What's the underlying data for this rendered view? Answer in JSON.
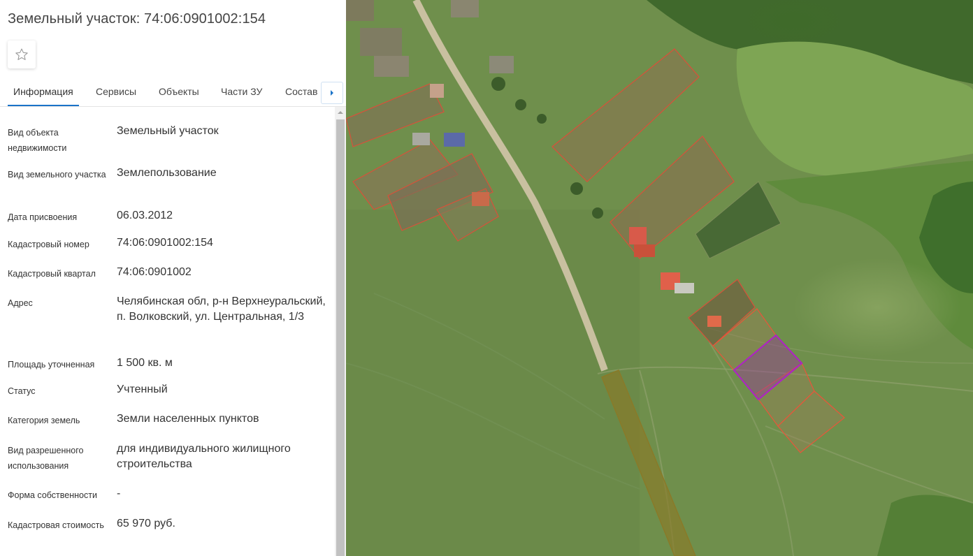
{
  "title": "Земельный участок: 74:06:0901002:154",
  "tabs": [
    "Информация",
    "Сервисы",
    "Объекты",
    "Части ЗУ",
    "Состав"
  ],
  "active_tab": "Информация",
  "rows": [
    {
      "label": "Вид объекта недвижимости",
      "value": "Земельный участок"
    },
    {
      "label": "Вид земельного участка",
      "value": "Землепользование"
    },
    {
      "label": "Дата присвоения",
      "value": "06.03.2012"
    },
    {
      "label": "Кадастровый номер",
      "value": "74:06:0901002:154"
    },
    {
      "label": "Кадастровый квартал",
      "value": "74:06:0901002"
    },
    {
      "label": "Адрес",
      "value": "Челябинская обл, р-н Верхнеуральский, п. Волковский, ул. Центральная, 1/3"
    },
    {
      "label": "Площадь уточненная",
      "value": "1 500 кв. м"
    },
    {
      "label": "Статус",
      "value": "Учтенный"
    },
    {
      "label": "Категория земель",
      "value": "Земли населенных пунктов"
    },
    {
      "label": "Вид разрешенного использования",
      "value": "для индивидуального жилищного строительства"
    },
    {
      "label": "Форма собственности",
      "value": "-"
    },
    {
      "label": "Кадастровая стоимость",
      "value": "65 970 руб."
    }
  ],
  "colors": {
    "accent": "#1a73c8",
    "parcel_border": "#e8563a",
    "selected_parcel": "#b020c8",
    "road_parcel": "#8a7a28"
  },
  "icons": [
    "star-icon",
    "chevron-right-icon",
    "chevron-up-icon"
  ]
}
